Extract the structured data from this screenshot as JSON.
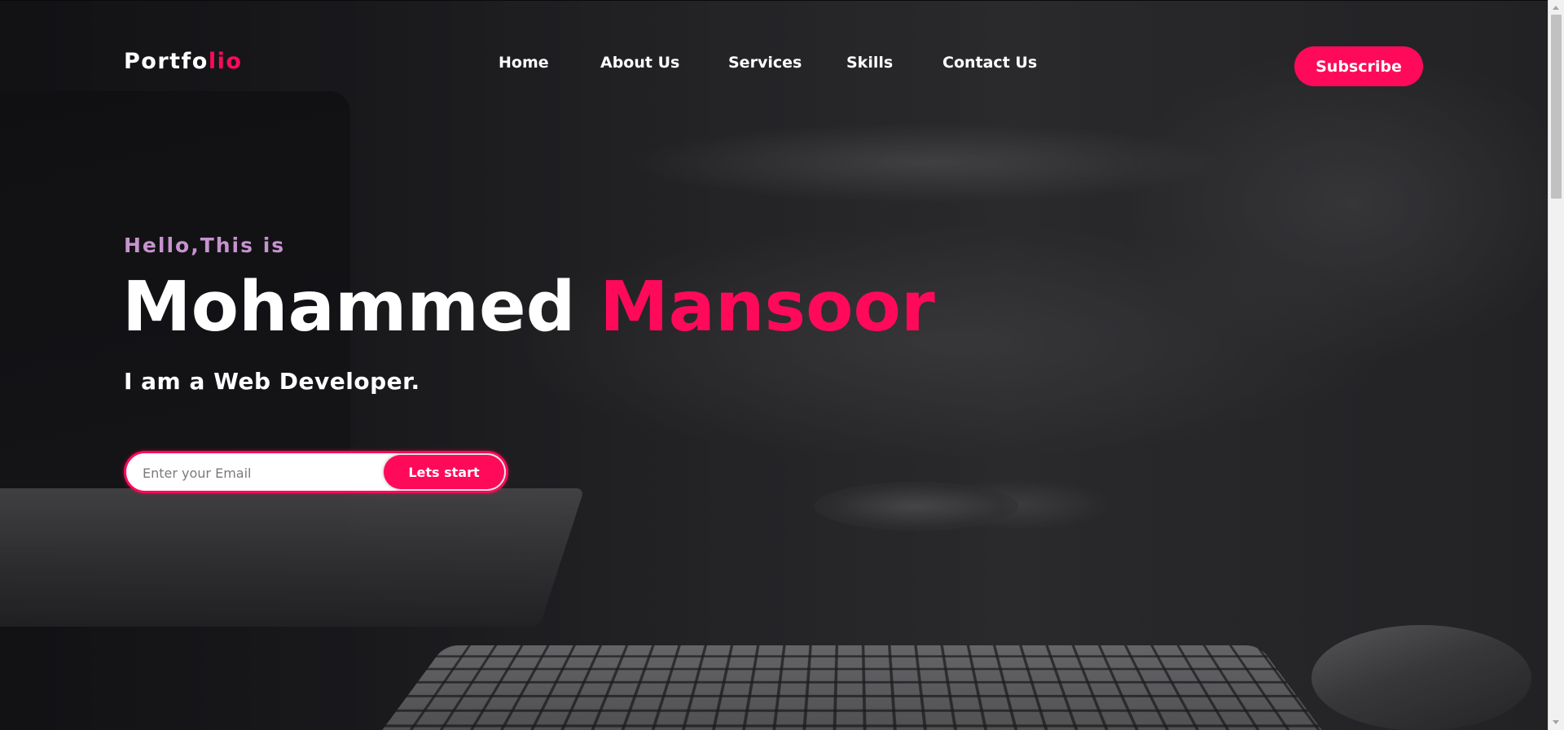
{
  "header": {
    "logo": {
      "main": "Portfo",
      "accent": "lio"
    },
    "nav": [
      {
        "label": "Home"
      },
      {
        "label": "About Us"
      },
      {
        "label": "Services"
      },
      {
        "label": "Skills"
      },
      {
        "label": "Contact Us"
      }
    ],
    "subscribe_label": "Subscribe"
  },
  "hero": {
    "greeting": "Hello,This is",
    "first_name": "Mohammed",
    "last_name": "Mansoor",
    "role": "I am a Web Developer.",
    "email_placeholder": "Enter your Email",
    "email_value": "",
    "start_label": "Lets start"
  },
  "colors": {
    "accent": "#ff0a5a",
    "greeting": "#c792cf",
    "text": "#ffffff"
  },
  "icons": [
    "scroll-up-arrow-icon",
    "scroll-down-arrow-icon"
  ]
}
